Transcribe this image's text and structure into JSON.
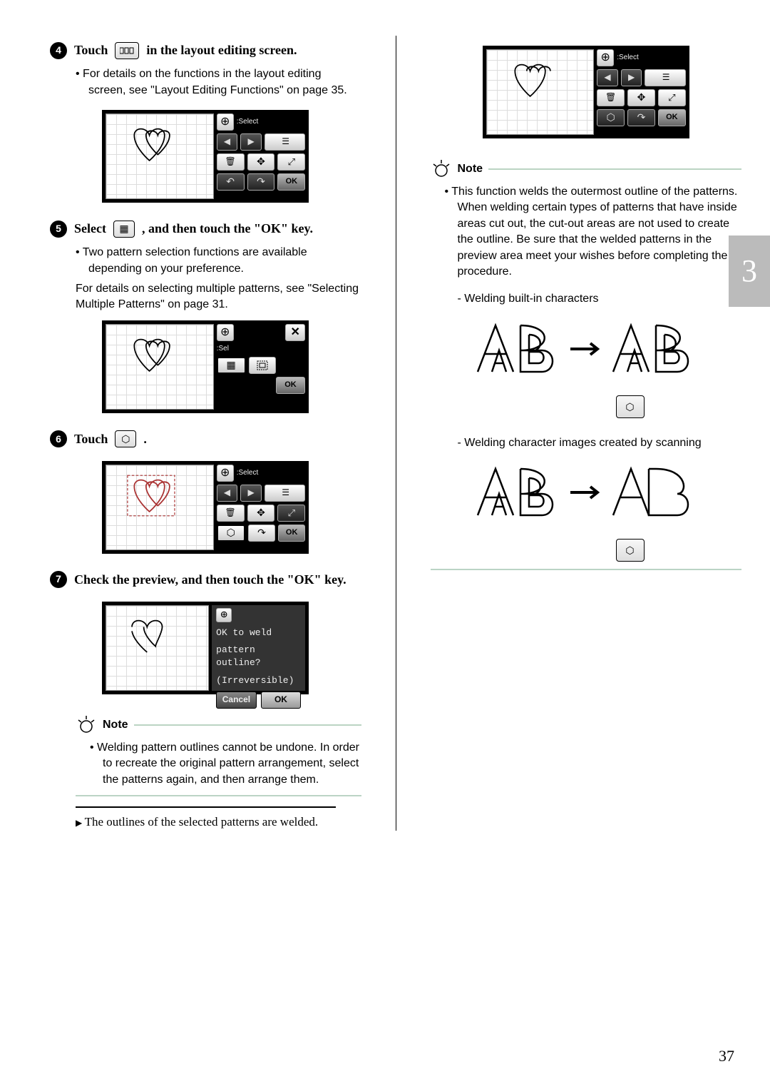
{
  "chapterTab": "3",
  "pageNumber": "37",
  "left": {
    "step4": {
      "prefix": "Touch",
      "suffix": "in the layout editing screen.",
      "bullet": "For details on the functions in the layout editing screen, see \"Layout Editing Functions\" on page 35."
    },
    "shot4": {
      "selectLabel": ":Select",
      "ok": "OK"
    },
    "step5": {
      "prefix": "Select",
      "suffix": ", and then touch the \"OK\" key.",
      "bullet1": "Two pattern selection functions are available depending on your preference.",
      "bullet2": "For details on selecting multiple patterns, see \"Selecting Multiple Patterns\" on page 31."
    },
    "shot5": {
      "selLabel": ":Sel",
      "ok": "OK"
    },
    "step6": {
      "prefix": "Touch",
      "suffix": "."
    },
    "shot6": {
      "selectLabel": ":Select",
      "ok": "OK"
    },
    "step7": {
      "text": "Check the preview, and then touch the \"OK\" key."
    },
    "shot7": {
      "line1": "OK to weld",
      "line2": "pattern outline?",
      "line3": "(Irreversible)",
      "cancel": "Cancel",
      "ok": "OK"
    },
    "note": {
      "title": "Note",
      "text": "Welding pattern outlines cannot be undone. In order to recreate the original pattern arrangement, select the patterns again, and then arrange them."
    },
    "result": "The outlines of the selected patterns are welded."
  },
  "right": {
    "shot": {
      "selectLabel": ":Select",
      "ok": "OK"
    },
    "note": {
      "title": "Note",
      "text": "This function welds the outermost outline of the patterns. When welding certain types of patterns that have inside areas cut out, the cut-out areas are not used to create the outline. Be sure that the welded patterns in the preview area meet your wishes before completing the procedure.",
      "sub1": "Welding built-in characters",
      "sub2": "Welding character images created by scanning"
    }
  }
}
